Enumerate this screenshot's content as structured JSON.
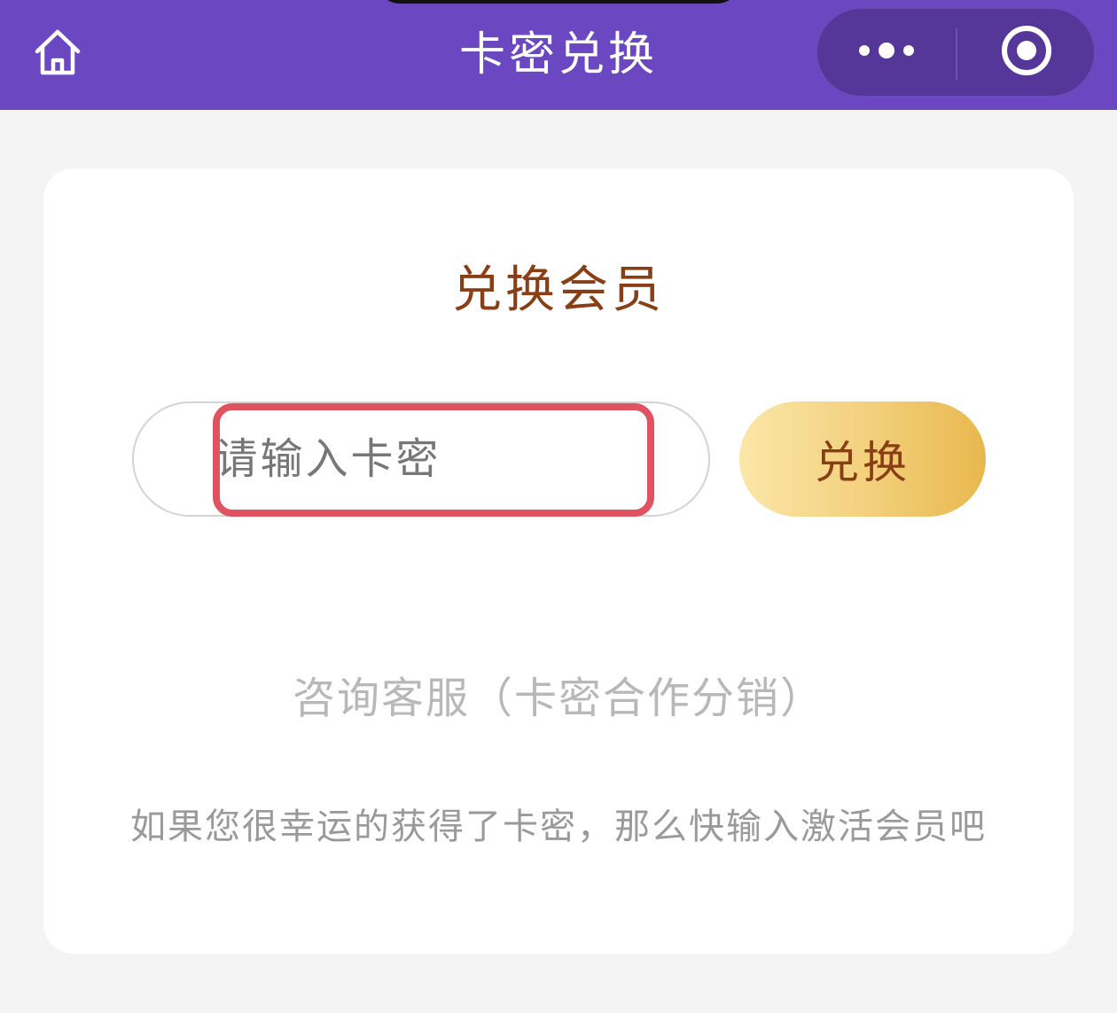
{
  "header": {
    "title": "卡密兑换",
    "home_icon": "home-icon",
    "more_icon": "more-dots-icon",
    "close_icon": "target-circle-icon",
    "background_color": "#6b47c2"
  },
  "redeem_card": {
    "title": "兑换会员",
    "input": {
      "placeholder": "请输入卡密",
      "value": ""
    },
    "redeem_button_label": "兑换",
    "consult_link": "咨询客服（卡密合作分销）",
    "hint": "如果您很幸运的获得了卡密，那么快输入激活会员吧",
    "title_color": "#8a3e15",
    "highlight_color": "#e05260"
  }
}
